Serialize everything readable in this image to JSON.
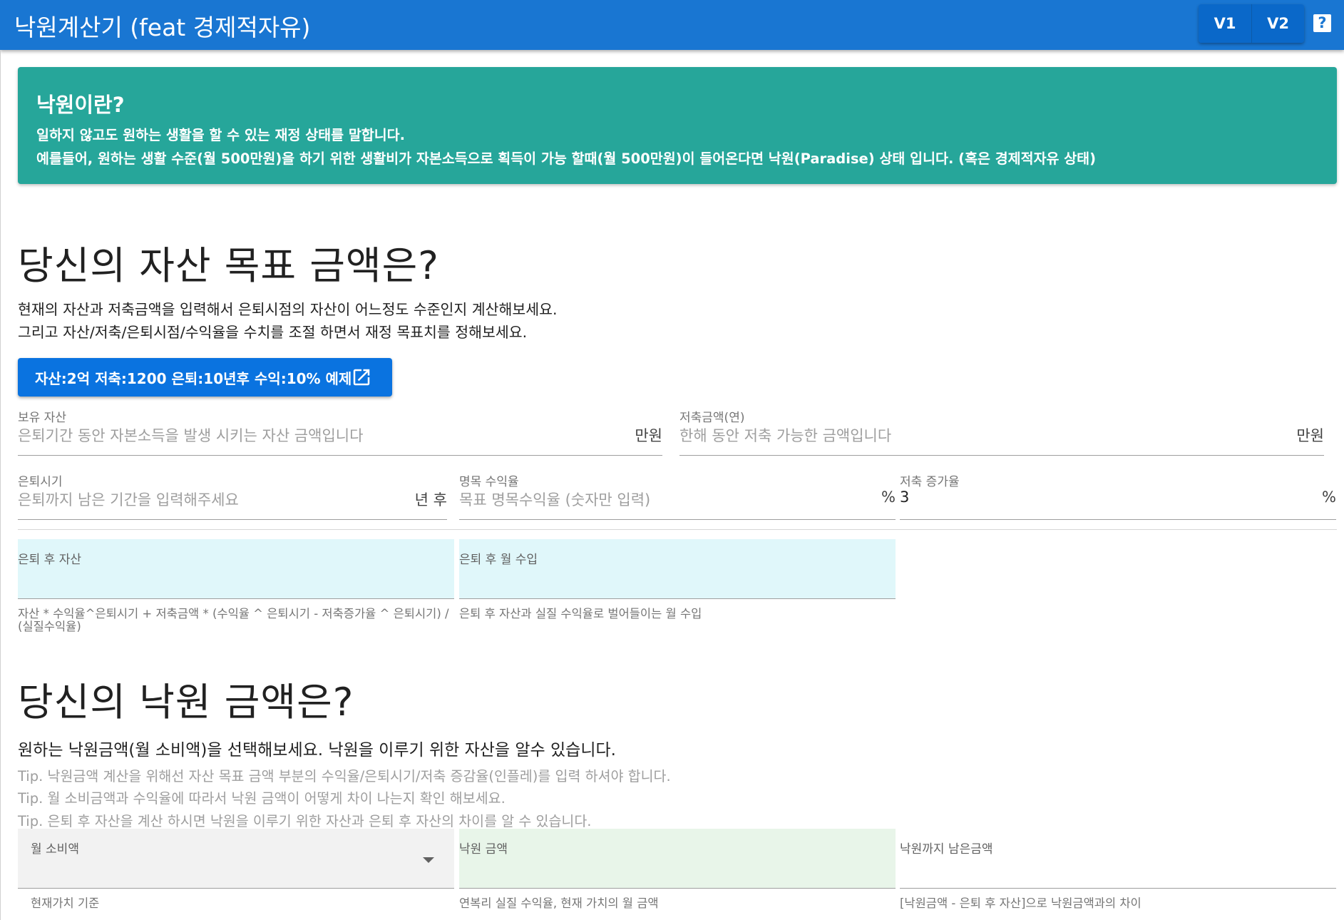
{
  "appbar": {
    "title": "낙원계산기 (feat 경제적자유)",
    "version_buttons": [
      "V1",
      "V2"
    ],
    "help_icon": "?"
  },
  "info_alert": {
    "title": "낙원이란?",
    "line1": "일하지 않고도 원하는 생활을 할 수 있는 재정 상태를 말합니다.",
    "line2": "예를들어, 원하는 생활 수준(월 500만원)을 하기 위한 생활비가 자본소득으로 획득이 가능 할때(월 500만원)이 들어온다면 낙원(Paradise) 상태 입니다. (혹은 경제적자유 상태)"
  },
  "goal_section": {
    "heading": "당신의 자산 목표 금액은?",
    "desc1": "현재의 자산과 저축금액을 입력해서 은퇴시점의 자산이 어느정도 수준인지 계산해보세요.",
    "desc2": "그리고 자산/저축/은퇴시점/수익율을 수치를 조절 하면서 재정 목표치를 정해보세요.",
    "example_button": "자산:2억 저축:1200 은퇴:10년후 수익:10% 예제",
    "fields": {
      "assets": {
        "label": "보유 자산",
        "placeholder": "은퇴기간 동안 자본소득을 발생 시키는 자산 금액입니다",
        "suffix": "만원"
      },
      "savings": {
        "label": "저축금액(연)",
        "placeholder": "한해 동안 저축 가능한 금액입니다",
        "suffix": "만원"
      },
      "retire": {
        "label": "은퇴시기",
        "placeholder": "은퇴까지 남은 기간을 입력해주세요",
        "suffix": "년 후"
      },
      "return_rate": {
        "label": "명목 수익율",
        "placeholder": "목표 명목수익율 (숫자만 입력)",
        "suffix": "%"
      },
      "savings_growth": {
        "label": "저축 증가율",
        "value": "3",
        "suffix": "%"
      }
    },
    "results": {
      "post_assets": {
        "label": "은퇴 후 자산",
        "hint": "자산 * 수익율^은퇴시기 + 저축금액 * (수익율 ^ 은퇴시기 - 저축증가율 ^ 은퇴시기) / (실질수익율)"
      },
      "monthly_income": {
        "label": "은퇴 후 월 수입",
        "hint": "은퇴 후 자산과 실질 수익율로 벌어들이는 월 수입"
      }
    }
  },
  "paradise_section": {
    "heading": "당신의 낙원 금액은?",
    "desc": "원하는 낙원금액(월 소비액)을 선택해보세요. 낙원을 이루기 위한 자산을 알수 있습니다.",
    "tips": [
      "Tip. 낙원금액 계산을 위해선 자산 목표 금액 부분의 수익율/은퇴시기/저축 증감율(인플레)를 입력 하셔야 합니다.",
      "Tip. 월 소비금액과 수익율에 따라서 낙원 금액이 어떻게 차이 나는지 확인 해보세요.",
      "Tip. 은퇴 후 자산을 계산 하시면 낙원을 이루기 위한 자산과 은퇴 후 자산의 차이를 알 수 있습니다."
    ],
    "monthly_spend": {
      "label": "월 소비액",
      "hint": "현재가치 기준"
    },
    "paradise_amount": {
      "label": "낙원 금액",
      "hint": "연복리 실질 수익율, 현재 가치의 월 금액"
    },
    "remaining": {
      "label": "낙원까지 남은금액",
      "hint": "[낙원금액 - 은퇴 후 자산]으로 낙원금액과의 차이"
    }
  },
  "colors": {
    "appbar": "#1976d2",
    "alert": "#26a69a",
    "example_button": "#0a73e0",
    "result_box": "#e0f7fa",
    "paradise_box": "#e8f5e9",
    "select_box": "#f2f2f2"
  }
}
